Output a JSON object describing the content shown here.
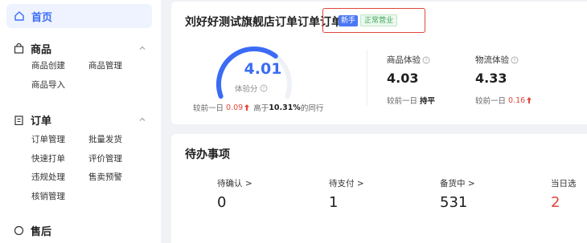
{
  "sidebar": {
    "home": {
      "label": "首页",
      "icon": "home-icon"
    },
    "sections": [
      {
        "title": "商品",
        "icon": "bag-icon",
        "items": [
          "商品创建",
          "商品管理",
          "商品导入"
        ]
      },
      {
        "title": "订单",
        "icon": "clipboard-icon",
        "items": [
          "订单管理",
          "批量发货",
          "快速打单",
          "评价管理",
          "违规处理",
          "售卖预警",
          "核销管理"
        ]
      },
      {
        "title": "售后",
        "icon": "service-icon",
        "items": []
      }
    ]
  },
  "store": {
    "title": "刘好好测试旗舰店订单订单订单",
    "badge_new": "新手",
    "badge_status": "正常营业"
  },
  "experience": {
    "score": "4.01",
    "score_fraction": 0.67,
    "label": "体验分",
    "compare_prefix": "较前一日",
    "compare_delta": "0.09",
    "peer_prefix": "高于",
    "peer_value": "10.31%",
    "peer_suffix": "的同行"
  },
  "metrics": [
    {
      "label": "商品体验",
      "value": "4.03",
      "compare_prefix": "较前一日",
      "compare_text": "持平",
      "trend": "flat"
    },
    {
      "label": "物流体验",
      "value": "4.33",
      "compare_prefix": "较前一日",
      "compare_text": "0.16",
      "trend": "up"
    }
  ],
  "todo": {
    "title": "待办事项",
    "items": [
      {
        "label": "待确认 >",
        "value": "0",
        "highlight": false
      },
      {
        "label": "待支付 >",
        "value": "1",
        "highlight": false
      },
      {
        "label": "备货中 >",
        "value": "531",
        "highlight": false
      },
      {
        "label": "当日选",
        "value": "2",
        "highlight": true
      }
    ]
  },
  "colors": {
    "accent": "#3b6bf5",
    "danger": "#e0463a",
    "success": "#3da85a"
  }
}
